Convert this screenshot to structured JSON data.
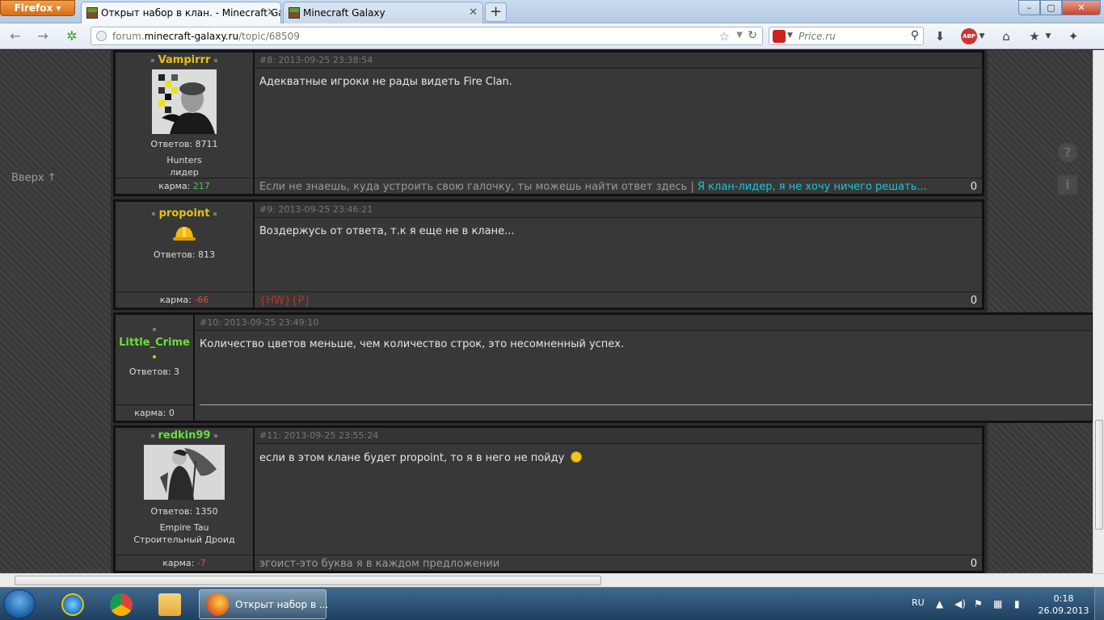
{
  "browser": {
    "menu_button": "Firefox",
    "tabs": [
      {
        "label": "Открыт набор в клан. - Minecraft Ga...",
        "active": true
      },
      {
        "label": "Minecraft Galaxy",
        "active": false
      }
    ],
    "new_tab": "+",
    "window": {
      "minimize": "–",
      "maximize": "▢",
      "close": "✕"
    },
    "url": {
      "prefix": "forum.",
      "domain": "minecraft-galaxy.ru",
      "path": "/topic/68509"
    },
    "search": {
      "placeholder": "Price.ru"
    },
    "abp_label": "ABP"
  },
  "page": {
    "back_to_top": "Вверх ↑",
    "posts": [
      {
        "author": "Vampirrr",
        "author_color": "#e6c21a",
        "replies": "Ответов: 8711",
        "clan": "Hunters",
        "role": "лидер",
        "karma_label": "карма:",
        "karma_value": "217",
        "karma_color": "#54c254",
        "meta": "#8: 2013-09-25 23:38:54",
        "text": "Адекватные игроки не рады видеть Fire Clan.",
        "signature": "Если не знаешь, куда устроить свою галочку, ты можешь найти ответ здесь",
        "signature_sep": "|",
        "signature_link": "Я клан-лидер, я не хочу ничего решать...",
        "count": "0"
      },
      {
        "author": "propoint",
        "author_color": "#e6c21a",
        "replies": "Ответов: 813",
        "karma_label": "карма:",
        "karma_value": "-66",
        "karma_color": "#d9533f",
        "meta": "#9: 2013-09-25 23:46:21",
        "text": "Воздержусь от ответа, т.к я еще не в клане...",
        "signature": "{HW}{P}",
        "count": "0"
      },
      {
        "author": "Little_Crime",
        "author_color": "#6adf3e",
        "replies": "Ответов: 3",
        "karma_label": "карма:",
        "karma_value": "0",
        "karma_color": "#dddddd",
        "meta": "#10: 2013-09-25 23:49:10",
        "text": "Количество цветов меньше, чем количество строк, это несомненный успех."
      },
      {
        "author": "redkin99",
        "author_color": "#6adf3e",
        "replies": "Ответов: 1350",
        "clan": "Empire Tau",
        "role": "Строительный Дроид",
        "karma_label": "карма:",
        "karma_value": "-7",
        "karma_color": "#d9533f",
        "meta": "#11: 2013-09-25 23:55:24",
        "text": "если в этом клане будет propoint, то я в него не пойду",
        "signature": "эгоист-это буква я в каждом предложении",
        "count": "0"
      }
    ]
  },
  "taskbar": {
    "active_window": "Открыт набор в ...",
    "language": "RU",
    "time": "0:18",
    "date": "26.09.2013"
  }
}
